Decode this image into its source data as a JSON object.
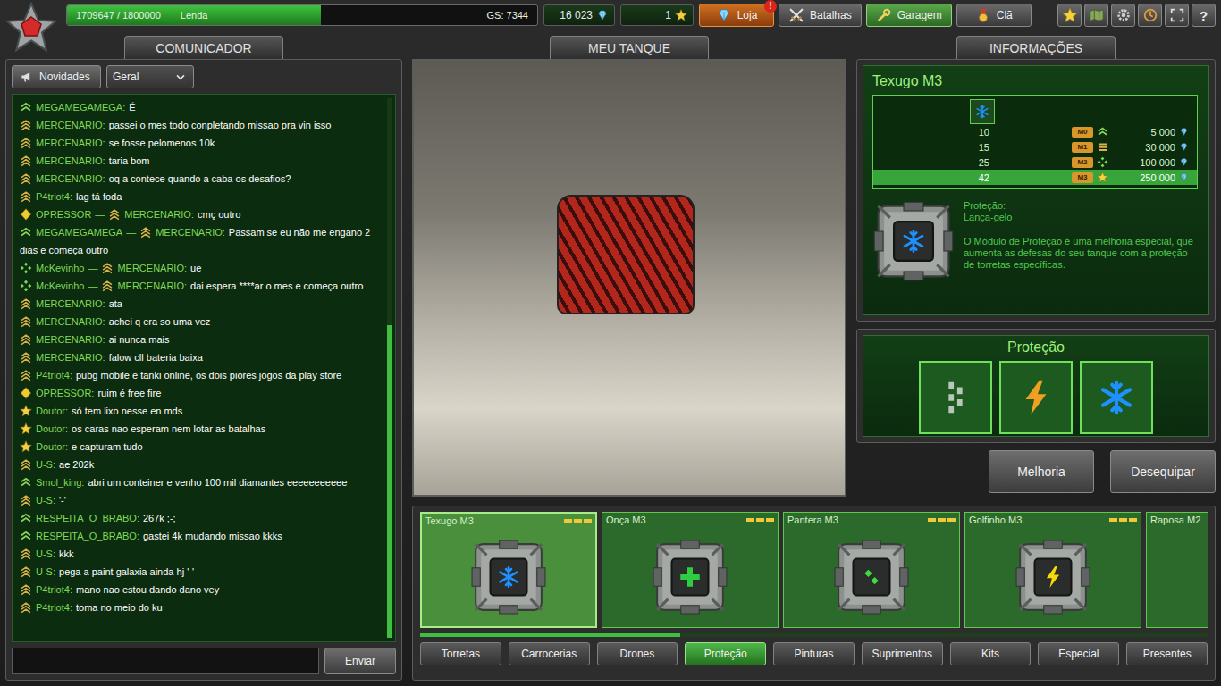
{
  "topbar": {
    "xp": {
      "text": "1709647 / 1800000",
      "rank": "Lenda",
      "gs": "GS: 7344",
      "level": 0.54
    },
    "crystals": "16 023",
    "stars": "1",
    "nav": [
      {
        "label": "Loja",
        "kind": "crystal",
        "badge": "!",
        "promo": true,
        "selected": false
      },
      {
        "label": "Batalhas",
        "kind": "swords",
        "promo": false,
        "selected": false
      },
      {
        "label": "Garagem",
        "kind": "wrench",
        "promo": false,
        "selected": true
      },
      {
        "label": "Clã",
        "kind": "medal",
        "promo": false,
        "selected": false
      }
    ],
    "icons": [
      {
        "kind": "star"
      },
      {
        "kind": "map"
      },
      {
        "kind": "gear"
      },
      {
        "kind": "quality"
      },
      {
        "kind": "fullscreen"
      },
      {
        "kind": "help",
        "label": "?"
      }
    ]
  },
  "sections": [
    "COMUNICADOR",
    "MEU TANQUE",
    "INFORMAÇÕES"
  ],
  "chat": {
    "news_button": "Novidades",
    "channel": "Geral",
    "send": "Enviar",
    "name_suffix": ":",
    "to_mark": "—",
    "scroll_level": 0.58,
    "messages": [
      {
        "rank": "corporal",
        "name": "MEGAMEGAMEGA",
        "text": "É"
      },
      {
        "rank": "sergeant",
        "name": "MERCENARIO",
        "text": "passei o mes todo conpletando missao pra vin isso"
      },
      {
        "rank": "sergeant",
        "name": "MERCENARIO",
        "text": "se fosse pelomenos 10k"
      },
      {
        "rank": "sergeant",
        "name": "MERCENARIO",
        "text": "taria bom"
      },
      {
        "rank": "sergeant",
        "name": "MERCENARIO",
        "text": "oq a contece quando a caba os desafios?"
      },
      {
        "rank": "sergeant",
        "name": "P4triot4",
        "text": "lag tá foda"
      },
      {
        "rank": "warrant",
        "name": "OPRESSOR",
        "to": {
          "rank": "sergeant",
          "name": "MERCENARIO"
        },
        "text": "cmç outro"
      },
      {
        "rank": "corporal",
        "name": "MEGAMEGAMEGA",
        "to": {
          "rank": "sergeant",
          "name": "MERCENARIO"
        },
        "text": "Passam se eu não me engano 2 dias e começa outro"
      },
      {
        "rank": "marshal",
        "name": "McKevinho",
        "to": {
          "rank": "sergeant",
          "name": "MERCENARIO"
        },
        "text": "ue"
      },
      {
        "rank": "marshal",
        "name": "McKevinho",
        "to": {
          "rank": "sergeant",
          "name": "MERCENARIO"
        },
        "text": "dai espera ****ar o mes e começa outro"
      },
      {
        "rank": "sergeant",
        "name": "MERCENARIO",
        "text": "ata"
      },
      {
        "rank": "sergeant",
        "name": "MERCENARIO",
        "text": "achei q era so uma vez"
      },
      {
        "rank": "sergeant",
        "name": "MERCENARIO",
        "text": "ai nunca mais"
      },
      {
        "rank": "sergeant",
        "name": "MERCENARIO",
        "text": "falow cll bateria baixa"
      },
      {
        "rank": "sergeant",
        "name": "P4triot4",
        "text": "pubg mobile e tanki online, os dois piores jogos da play store"
      },
      {
        "rank": "warrant",
        "name": "OPRESSOR",
        "text": "ruim é free fire"
      },
      {
        "rank": "general",
        "name": "Doutor",
        "text": "só tem lixo nesse en mds"
      },
      {
        "rank": "general",
        "name": "Doutor",
        "text": "os caras nao esperam nem lotar as batalhas"
      },
      {
        "rank": "general",
        "name": "Doutor",
        "text": "e capturam tudo"
      },
      {
        "rank": "sergeant",
        "name": "U-S",
        "text": "ae 202k"
      },
      {
        "rank": "corporal",
        "name": "Smol_king",
        "text": "abri um conteiner e venho 100 mil diamantes eeeeeeeeeee"
      },
      {
        "rank": "sergeant",
        "name": "U-S",
        "text": "'-'"
      },
      {
        "rank": "corporal",
        "name": "RESPEITA_O_BRABO",
        "text": "267k ;-;"
      },
      {
        "rank": "corporal",
        "name": "RESPEITA_O_BRABO",
        "text": "gastei 4k mudando missao kkks"
      },
      {
        "rank": "sergeant",
        "name": "U-S",
        "text": "kkk"
      },
      {
        "rank": "sergeant",
        "name": "U-S",
        "text": "pega a paint galaxia ainda hj '-'"
      },
      {
        "rank": "sergeant",
        "name": "P4triot4",
        "text": "mano nao estou dando dano vey"
      },
      {
        "rank": "sergeant",
        "name": "P4triot4",
        "text": "toma no meio do ku"
      }
    ]
  },
  "info": {
    "title": "Texugo M3",
    "header_icon": {
      "kind": "snowflake",
      "color": "#1e90ff"
    },
    "rows": [
      {
        "level": "10",
        "mark": "M0",
        "rank": "corporal",
        "price": "5 000",
        "selected": false
      },
      {
        "level": "15",
        "mark": "M1",
        "rank": "lieutenant",
        "price": "30 000",
        "selected": false
      },
      {
        "level": "25",
        "mark": "M2",
        "rank": "marshal",
        "price": "100 000",
        "selected": false
      },
      {
        "level": "42",
        "mark": "M3",
        "rank": "general",
        "price": "250 000",
        "selected": true
      }
    ],
    "label": "Proteção:",
    "resist": "Lança-gelo",
    "description": "O Módulo de Proteção é uma melhoria especial, que aumenta as defesas do seu tanque com a proteção de torretas específicas.",
    "module": {
      "kind": "snowflake",
      "color": "#1e90ff"
    }
  },
  "protection": {
    "title": "Proteção",
    "slots": [
      {
        "kind": "dashes",
        "color": "#b9c6b9"
      },
      {
        "kind": "bolt",
        "color": "#f0a020"
      },
      {
        "kind": "snowflake",
        "color": "#1e90ff"
      }
    ]
  },
  "actions": [
    "Melhoria",
    "Desequipar"
  ],
  "items": {
    "scroll_level": 0.33,
    "cards": [
      {
        "name": "Texugo M3",
        "upgrades": 3,
        "selected": true,
        "icon": {
          "kind": "snowflake",
          "color": "#1e90ff"
        }
      },
      {
        "name": "Onça M3",
        "upgrades": 3,
        "selected": false,
        "icon": {
          "kind": "plus",
          "color": "#2ecc40"
        }
      },
      {
        "name": "Pantera M3",
        "upgrades": 3,
        "selected": false,
        "icon": {
          "kind": "diamonds",
          "color": "#3ddc3d"
        }
      },
      {
        "name": "Golfinho M3",
        "upgrades": 3,
        "selected": false,
        "icon": {
          "kind": "bolt",
          "color": "#f5d90a"
        }
      },
      {
        "name": "Raposa M2",
        "upgrades": 2,
        "selected": false
      }
    ]
  },
  "tabs": [
    {
      "label": "Torretas",
      "selected": false
    },
    {
      "label": "Carrocerias",
      "selected": false
    },
    {
      "label": "Drones",
      "selected": false
    },
    {
      "label": "Proteção",
      "selected": true
    },
    {
      "label": "Pinturas",
      "selected": false
    },
    {
      "label": "Suprimentos",
      "selected": false
    },
    {
      "label": "Kits",
      "selected": false
    },
    {
      "label": "Especial",
      "selected": false
    },
    {
      "label": "Presentes",
      "selected": false
    }
  ]
}
